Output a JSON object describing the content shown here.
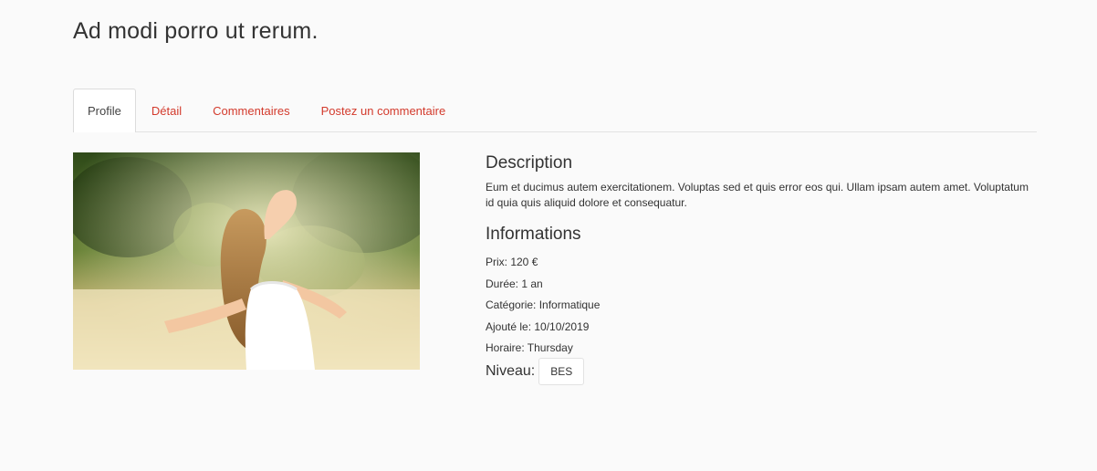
{
  "page": {
    "title": "Ad modi porro ut rerum."
  },
  "tabs": [
    {
      "label": "Profile",
      "active": true
    },
    {
      "label": "Détail",
      "active": false
    },
    {
      "label": "Commentaires",
      "active": false
    },
    {
      "label": "Postez un commentaire",
      "active": false
    }
  ],
  "description": {
    "heading": "Description",
    "text": "Eum et ducimus autem exercitationem. Voluptas sed et quis error eos qui. Ullam ipsam autem amet. Voluptatum id quia quis aliquid dolore et consequatur."
  },
  "informations": {
    "heading": "Informations",
    "rows": [
      "Prix: 120 €",
      "Durée: 1 an",
      "Catégorie: Informatique",
      "Ajouté le: 10/10/2019",
      "Horaire: Thursday"
    ],
    "level_label": "Niveau:",
    "level_value": "BES"
  },
  "colors": {
    "accent": "#d33a2c",
    "background": "#fafafa"
  },
  "image": {
    "subject": "woman-in-field-photo"
  }
}
